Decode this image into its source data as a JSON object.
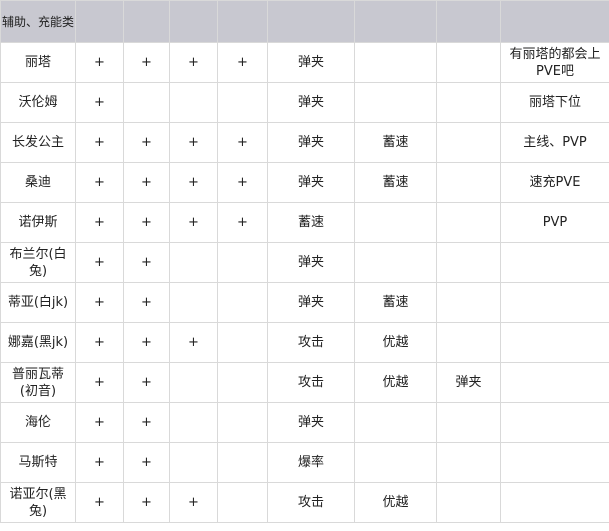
{
  "header": {
    "title": "辅助、充能类",
    "columns": [
      "",
      "",
      "",
      "",
      "",
      "",
      "",
      ""
    ]
  },
  "rows": [
    {
      "name": "丽塔",
      "c1": "+",
      "c2": "+",
      "c3": "+",
      "c4": "+",
      "c5": "弹夹",
      "c6": "",
      "c7": "",
      "note": "有丽塔的都会上PVE吧"
    },
    {
      "name": "沃伦姆",
      "c1": "+",
      "c2": "",
      "c3": "",
      "c4": "",
      "c5": "弹夹",
      "c6": "",
      "c7": "",
      "note": "丽塔下位"
    },
    {
      "name": "长发公主",
      "c1": "+",
      "c2": "+",
      "c3": "+",
      "c4": "+",
      "c5": "弹夹",
      "c6": "蓄速",
      "c7": "",
      "note": "主线、PVP"
    },
    {
      "name": "桑迪",
      "c1": "+",
      "c2": "+",
      "c3": "+",
      "c4": "+",
      "c5": "弹夹",
      "c6": "蓄速",
      "c7": "",
      "note": "速充PVE"
    },
    {
      "name": "诺伊斯",
      "c1": "+",
      "c2": "+",
      "c3": "+",
      "c4": "+",
      "c5": "蓄速",
      "c6": "",
      "c7": "",
      "note": "PVP"
    },
    {
      "name": "布兰尔(白兔)",
      "c1": "+",
      "c2": "+",
      "c3": "",
      "c4": "",
      "c5": "弹夹",
      "c6": "",
      "c7": "",
      "note": ""
    },
    {
      "name": "蒂亚(白jk)",
      "c1": "+",
      "c2": "+",
      "c3": "",
      "c4": "",
      "c5": "弹夹",
      "c6": "蓄速",
      "c7": "",
      "note": ""
    },
    {
      "name": "娜嘉(黑jk)",
      "c1": "+",
      "c2": "+",
      "c3": "+",
      "c4": "",
      "c5": "攻击",
      "c6": "优越",
      "c7": "",
      "note": ""
    },
    {
      "name": "普丽瓦蒂(初音)",
      "c1": "+",
      "c2": "+",
      "c3": "",
      "c4": "",
      "c5": "攻击",
      "c6": "优越",
      "c7": "弹夹",
      "note": ""
    },
    {
      "name": "海伦",
      "c1": "+",
      "c2": "+",
      "c3": "",
      "c4": "",
      "c5": "弹夹",
      "c6": "",
      "c7": "",
      "note": ""
    },
    {
      "name": "马斯特",
      "c1": "+",
      "c2": "+",
      "c3": "",
      "c4": "",
      "c5": "爆率",
      "c6": "",
      "c7": "",
      "note": ""
    },
    {
      "name": "诺亚尔(黑兔)",
      "c1": "+",
      "c2": "+",
      "c3": "+",
      "c4": "",
      "c5": "攻击",
      "c6": "优越",
      "c7": "",
      "note": ""
    }
  ]
}
